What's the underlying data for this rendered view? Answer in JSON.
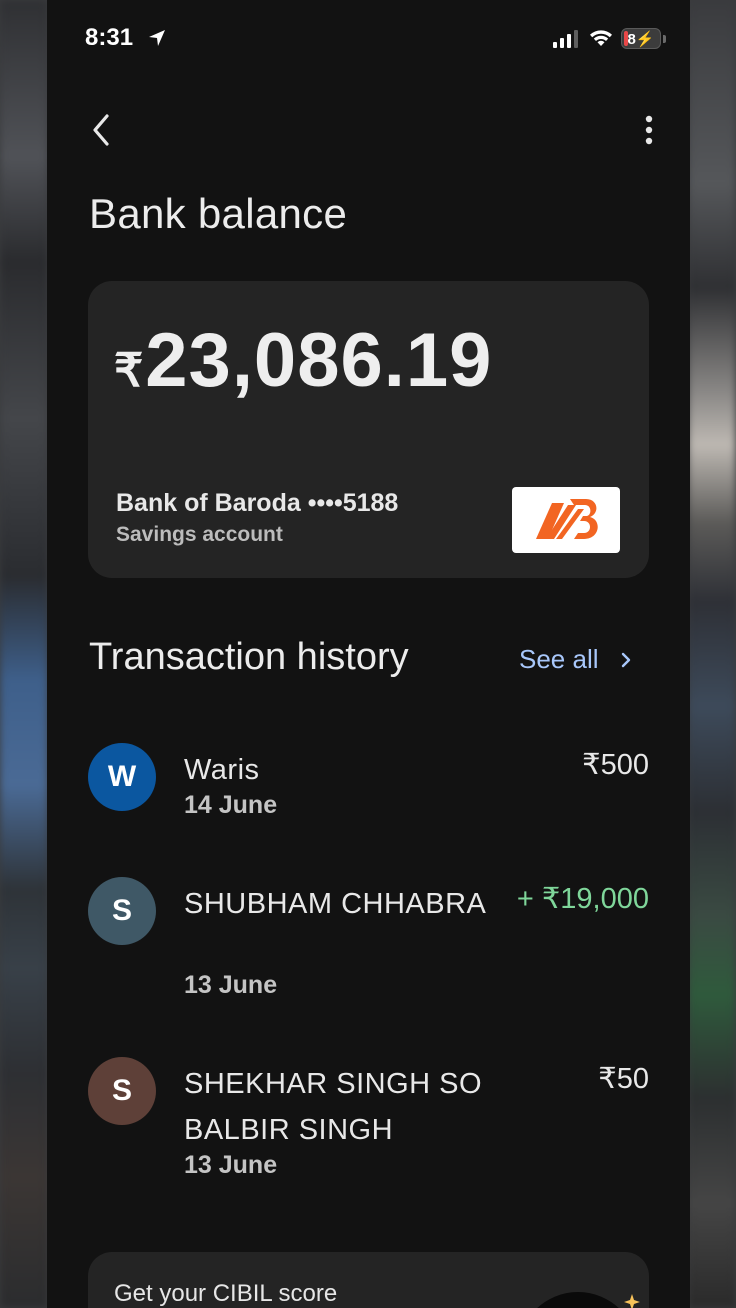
{
  "status_bar": {
    "time": "8:31",
    "battery": "8",
    "battery_level": 0.08,
    "icons": [
      "location-arrow-icon",
      "cellular-signal-icon",
      "wifi-icon",
      "battery-charging-icon"
    ]
  },
  "header": {
    "back_icon": "chevron-left-icon",
    "menu_icon": "more-vertical-icon",
    "title": "Bank balance"
  },
  "balance_card": {
    "currency": "₹",
    "amount": "23,086.19",
    "bank_line": "Bank of Baroda ••••5188",
    "account_type": "Savings account",
    "logo": "bank-of-baroda-logo",
    "logo_color": "#f26522"
  },
  "transactions": {
    "title": "Transaction history",
    "see_all": "See all",
    "see_all_color": "#a8c7fa",
    "items": [
      {
        "initial": "W",
        "name": "Waris",
        "date": "14 June",
        "amount": "₹500",
        "avatar_color": "#0b57a0"
      },
      {
        "initial": "S",
        "name": "SHUBHAM CHHABRA",
        "date": "13 June",
        "amount": "+ ₹19,000",
        "credit": true,
        "avatar_color": "#3f5866"
      },
      {
        "initial": "S",
        "name": "SHEKHAR SINGH SO BALBIR SINGH",
        "date": "13 June",
        "amount": "₹50",
        "avatar_color": "#5e4038"
      }
    ]
  },
  "promo": {
    "text": "Get your CIBIL score"
  }
}
